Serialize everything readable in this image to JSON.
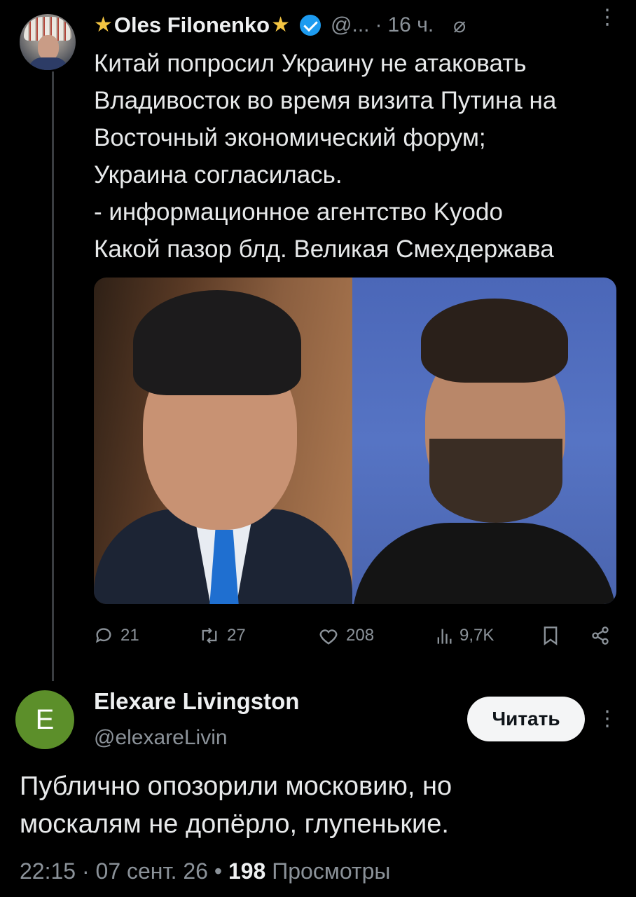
{
  "tweet": {
    "author_name": "Oles Filonenko",
    "star_glyph": "★",
    "handle": "@...",
    "separator": "·",
    "time": "16 ч.",
    "grok_icon_glyph": "⌀",
    "more_glyph": "⋮",
    "text_lines": [
      "Китай попросил Украину не атаковать",
      "Владивосток во время визита Путина на",
      "Восточный экономический форум;",
      "Украина согласилась.",
      "- информационное агентство Kyodo",
      "Какой пазор блд.  Великая Смехдержава"
    ],
    "actions": {
      "replies": "21",
      "reposts": "27",
      "likes": "208",
      "views": "9,7K"
    },
    "icons": {
      "reply": "reply-icon",
      "repost": "repost-icon",
      "like": "heart-icon",
      "views": "views-chart-icon",
      "bookmark": "bookmark-icon",
      "share": "share-icon"
    }
  },
  "reply": {
    "avatar_letter": "E",
    "avatar_color": "#5c8f2a",
    "author_name": "Elexare Livingston",
    "handle": "@elexareLivin",
    "follow_label": "Читать",
    "more_glyph": "⋮",
    "text_lines": [
      "Публично опозорили московию, но",
      "москалям не допёрло, глупенькие."
    ],
    "time": "22:15",
    "date": "07 сент. 26",
    "sep": "·",
    "sep_bold": "•",
    "views_count": "198",
    "views_label": "Просмотры"
  },
  "colors": {
    "background": "#000000",
    "text": "#e7e9ea",
    "muted": "#8b9299",
    "verified": "#1d9bf0",
    "star": "#f4c542"
  }
}
